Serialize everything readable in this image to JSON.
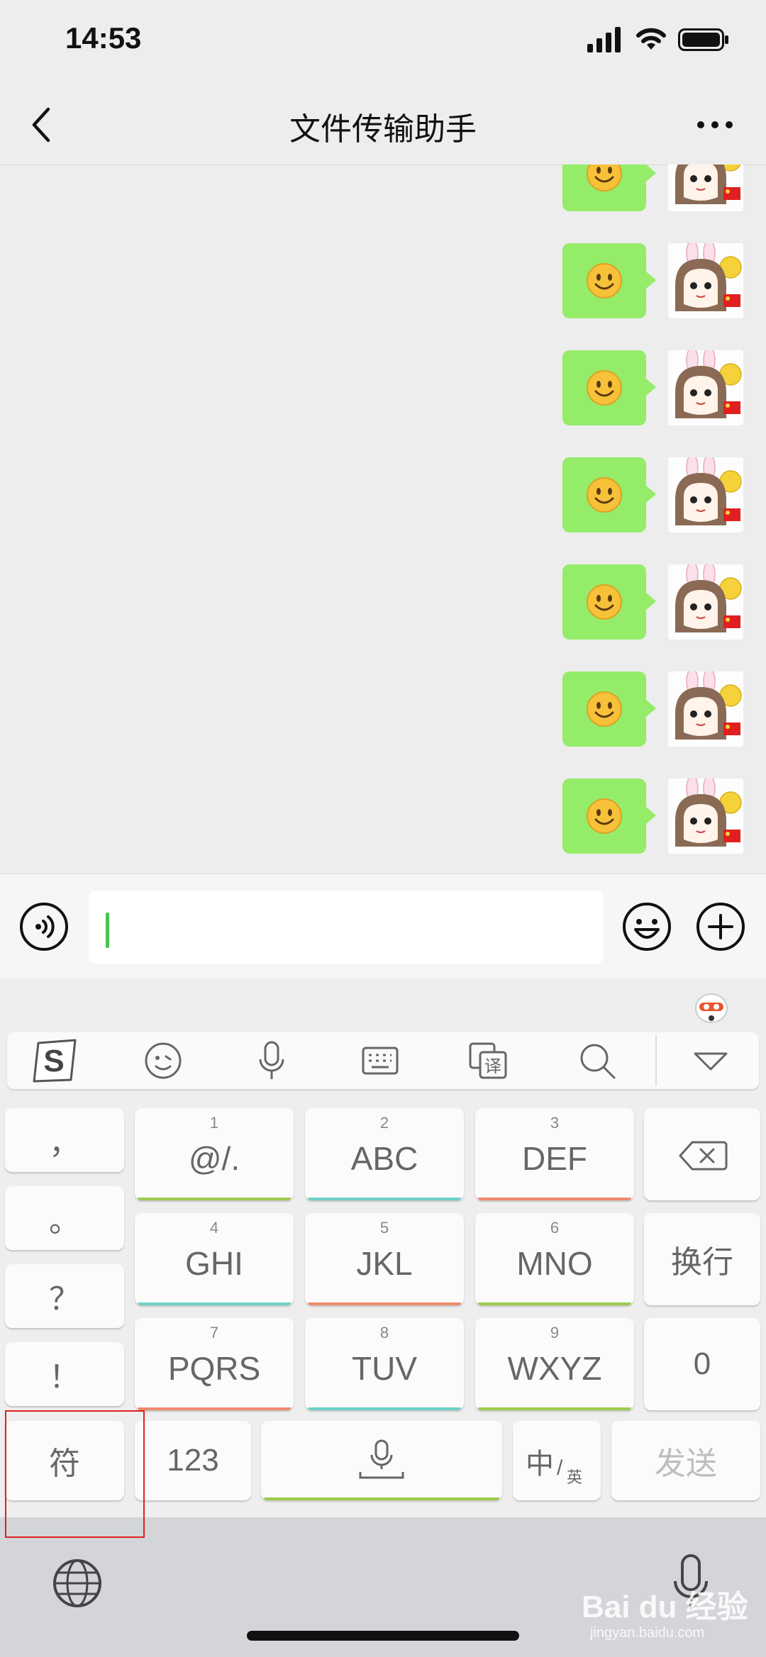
{
  "status_bar": {
    "time": "14:53"
  },
  "nav": {
    "title": "文件传输助手"
  },
  "chat": {
    "message_count": 7,
    "bubble_emoji": "smiley"
  },
  "input": {
    "value": ""
  },
  "keyboard": {
    "punct_keys": [
      "，",
      "。",
      "？",
      "！"
    ],
    "keys": [
      {
        "num": "1",
        "letters": "@/."
      },
      {
        "num": "2",
        "letters": "ABC"
      },
      {
        "num": "3",
        "letters": "DEF"
      },
      {
        "num": "4",
        "letters": "GHI"
      },
      {
        "num": "5",
        "letters": "JKL"
      },
      {
        "num": "6",
        "letters": "MNO"
      },
      {
        "num": "7",
        "letters": "PQRS"
      },
      {
        "num": "8",
        "letters": "TUV"
      },
      {
        "num": "9",
        "letters": "WXYZ"
      }
    ],
    "newline": "换行",
    "zero": "0",
    "symbol": "符",
    "numeric": "123",
    "lang_main": "中",
    "lang_sub": "英",
    "send": "发送"
  },
  "watermark": {
    "main": "Bai du 经验",
    "sub": "jingyan.baidu.com"
  },
  "colors": {
    "bubble": "#95ec69",
    "cursor": "#4cc34c",
    "highlight": "#e02020"
  }
}
